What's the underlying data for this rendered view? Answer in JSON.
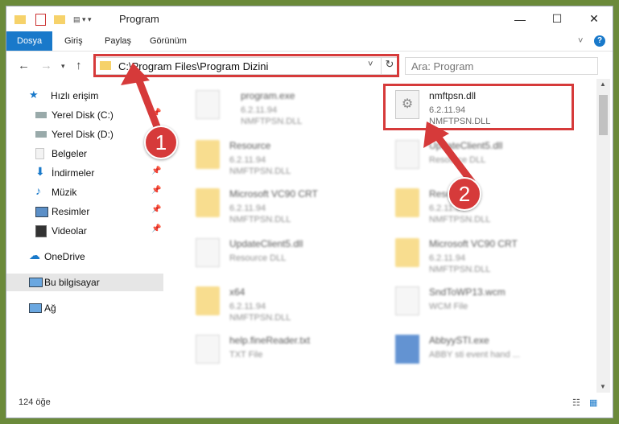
{
  "window": {
    "title": "Program",
    "controls": {
      "minimize": "—",
      "maximize": "☐",
      "close": "✕"
    }
  },
  "ribbon": {
    "tabs": [
      "Dosya",
      "Giriş",
      "Paylaş",
      "Görünüm"
    ],
    "help_glyph": "?",
    "expand_glyph": "˅"
  },
  "address": {
    "path": "C:\\Program Files\\Program Dizini",
    "search_placeholder": "Ara: Program"
  },
  "sidebar": {
    "items": [
      {
        "label": "Hızlı erişim",
        "icon": "star-icon"
      },
      {
        "label": "Yerel Disk (C:)",
        "icon": "drive-icon"
      },
      {
        "label": "Yerel Disk (D:)",
        "icon": "drive-icon"
      },
      {
        "label": "Belgeler",
        "icon": "documents-icon"
      },
      {
        "label": "İndirmeler",
        "icon": "download-icon"
      },
      {
        "label": "Müzik",
        "icon": "music-icon"
      },
      {
        "label": "Resimler",
        "icon": "pictures-icon"
      },
      {
        "label": "Videolar",
        "icon": "videos-icon"
      },
      {
        "label": "OneDrive",
        "icon": "cloud-icon"
      },
      {
        "label": "Bu bilgisayar",
        "icon": "computer-icon"
      },
      {
        "label": "Ağ",
        "icon": "network-icon"
      }
    ]
  },
  "files": [
    {
      "name": "program.exe",
      "line1": "6.2.11.94",
      "line2": "NMFTPSN.DLL",
      "kind": "exe"
    },
    {
      "name": "nmftpsn.dll",
      "line1": "6.2.11.94",
      "line2": "NMFTPSN.DLL",
      "kind": "dll"
    },
    {
      "name": "Resource",
      "line1": "6.2.11.94",
      "line2": "NMFTPSN.DLL",
      "kind": "folder"
    },
    {
      "name": "UpdateClient5.dll",
      "line1": "Resource DLL",
      "line2": "",
      "kind": "dll"
    },
    {
      "name": "Microsoft VC90 CRT",
      "line1": "6.2.11.94",
      "line2": "NMFTPSN.DLL",
      "kind": "folder"
    },
    {
      "name": "Resource",
      "line1": "6.2.11.94",
      "line2": "NMFTPSN.DLL",
      "kind": "folder"
    },
    {
      "name": "UpdateClient5.dll",
      "line1": "Resource DLL",
      "line2": "",
      "kind": "dll"
    },
    {
      "name": "Microsoft VC90 CRT",
      "line1": "6.2.11.94",
      "line2": "NMFTPSN.DLL",
      "kind": "folder"
    },
    {
      "name": "x64",
      "line1": "6.2.11.94",
      "line2": "NMFTPSN.DLL",
      "kind": "folder"
    },
    {
      "name": "SndToWP13.wcm",
      "line1": "WCM File",
      "line2": "",
      "kind": "doc"
    },
    {
      "name": "help.fineReader.txt",
      "line1": "TXT File",
      "line2": "",
      "kind": "doc"
    },
    {
      "name": "AbbyySTI.exe",
      "line1": "ABBY sti event hand ...",
      "line2": "",
      "kind": "exe"
    }
  ],
  "status": {
    "count": "124 öğe"
  },
  "annotations": {
    "badge1": "1",
    "badge2": "2"
  },
  "colors": {
    "accent": "#1979ca",
    "annotation": "#d63a3a"
  }
}
